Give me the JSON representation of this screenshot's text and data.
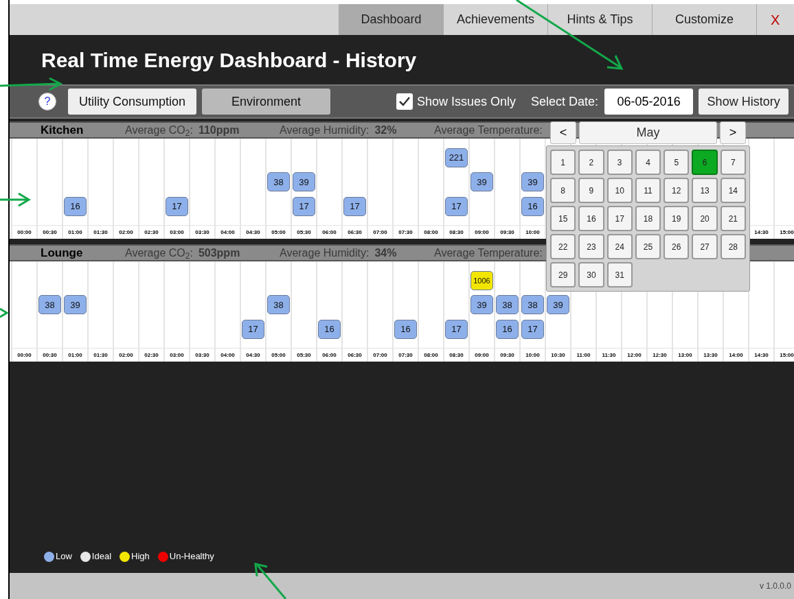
{
  "tabs": [
    {
      "label": "Dashboard",
      "selected": true
    },
    {
      "label": "Achievements",
      "selected": false
    },
    {
      "label": "Hints & Tips",
      "selected": false
    },
    {
      "label": "Customize",
      "selected": false
    }
  ],
  "close_label": "X",
  "title": "Real Time Energy Dashboard - History",
  "toolbar": {
    "help": "?",
    "views": [
      {
        "label": "Utility Consumption",
        "selected": false
      },
      {
        "label": "Environment",
        "selected": true
      }
    ],
    "show_issues": {
      "label": "Show Issues Only",
      "checked": true
    },
    "date_label": "Select Date:",
    "date_value": "06-05-2016",
    "show_history": "Show History"
  },
  "rooms": [
    {
      "name": "Kitchen",
      "stats": [
        {
          "label": "Average CO$_{2}$:",
          "value": "110ppm"
        },
        {
          "label": "Average Humidity:",
          "value": "32%"
        },
        {
          "label": "Average Temperature:"
        }
      ],
      "columns": [
        {
          "time": "00:00"
        },
        {
          "time": "00:30"
        },
        {
          "time": "01:00",
          "bottom": {
            "value": "16",
            "color": "#8eb0ea"
          }
        },
        {
          "time": "01:30"
        },
        {
          "time": "02:00"
        },
        {
          "time": "02:30"
        },
        {
          "time": "03:00",
          "bottom": {
            "value": "17",
            "color": "#8eb0ea"
          }
        },
        {
          "time": "03:30"
        },
        {
          "time": "04:00"
        },
        {
          "time": "04:30"
        },
        {
          "time": "05:00",
          "middle": {
            "value": "38",
            "color": "#8eb0ea"
          }
        },
        {
          "time": "05:30",
          "middle": {
            "value": "39",
            "color": "#8eb0ea"
          },
          "bottom": {
            "value": "17",
            "color": "#8eb0ea"
          }
        },
        {
          "time": "06:00"
        },
        {
          "time": "06:30",
          "bottom": {
            "value": "17",
            "color": "#8eb0ea"
          }
        },
        {
          "time": "07:00"
        },
        {
          "time": "07:30"
        },
        {
          "time": "08:00"
        },
        {
          "time": "08:30",
          "top": {
            "value": "221",
            "color": "#8eb0ea"
          },
          "bottom": {
            "value": "17",
            "color": "#8eb0ea"
          }
        },
        {
          "time": "09:00",
          "middle": {
            "value": "39",
            "color": "#8eb0ea"
          }
        },
        {
          "time": "09:30"
        },
        {
          "time": "10:00",
          "middle": {
            "value": "39",
            "color": "#8eb0ea"
          },
          "bottom": {
            "value": "16",
            "color": "#8eb0ea"
          }
        }
      ],
      "trailing_columns": [
        {
          "time": "14:30"
        },
        {
          "time": "15:00"
        }
      ]
    },
    {
      "name": "Lounge",
      "stats": [
        {
          "label": "Average CO$_{2}$:",
          "value": "503ppm"
        },
        {
          "label": "Average Humidity:",
          "value": "34%"
        },
        {
          "label": "Average Temperature:"
        }
      ],
      "columns": [
        {
          "time": "00:00"
        },
        {
          "time": "00:30",
          "middle": {
            "value": "38",
            "color": "#8eb0ea"
          }
        },
        {
          "time": "01:00",
          "middle": {
            "value": "39",
            "color": "#8eb0ea"
          }
        },
        {
          "time": "01:30"
        },
        {
          "time": "02:00"
        },
        {
          "time": "02:30"
        },
        {
          "time": "03:00"
        },
        {
          "time": "03:30"
        },
        {
          "time": "04:00"
        },
        {
          "time": "04:30",
          "bottom": {
            "value": "17",
            "color": "#8eb0ea"
          }
        },
        {
          "time": "05:00",
          "middle": {
            "value": "38",
            "color": "#8eb0ea"
          }
        },
        {
          "time": "05:30"
        },
        {
          "time": "06:00",
          "bottom": {
            "value": "16",
            "color": "#8eb0ea"
          }
        },
        {
          "time": "06:30"
        },
        {
          "time": "07:00"
        },
        {
          "time": "07:30",
          "bottom": {
            "value": "16",
            "color": "#8eb0ea"
          }
        },
        {
          "time": "08:00"
        },
        {
          "time": "08:30",
          "bottom": {
            "value": "17",
            "color": "#8eb0ea"
          }
        },
        {
          "time": "09:00",
          "top": {
            "value": "1006",
            "color": "#f2e600"
          },
          "middle": {
            "value": "39",
            "color": "#8eb0ea"
          }
        },
        {
          "time": "09:30",
          "middle": {
            "value": "38",
            "color": "#8eb0ea"
          },
          "bottom": {
            "value": "16",
            "color": "#8eb0ea"
          }
        },
        {
          "time": "10:00",
          "middle": {
            "value": "38",
            "color": "#8eb0ea"
          },
          "bottom": {
            "value": "17",
            "color": "#8eb0ea"
          }
        },
        {
          "time": "10:30",
          "middle": {
            "value": "39",
            "color": "#8eb0ea"
          }
        },
        {
          "time": "11:00"
        },
        {
          "time": "11:30"
        },
        {
          "time": "12:00"
        },
        {
          "time": "12:30"
        },
        {
          "time": "13:00"
        },
        {
          "time": "13:30"
        },
        {
          "time": "14:00"
        },
        {
          "time": "14:30"
        },
        {
          "time": "15:00"
        }
      ]
    }
  ],
  "calendar": {
    "prev": "<",
    "month": "May",
    "next": ">",
    "days": [
      {
        "label": "1",
        "selected": false
      },
      {
        "label": "2",
        "selected": false
      },
      {
        "label": "3",
        "selected": false
      },
      {
        "label": "4",
        "selected": false
      },
      {
        "label": "5",
        "selected": false
      },
      {
        "label": "6",
        "selected": true
      },
      {
        "label": "7",
        "selected": false
      },
      {
        "label": "8",
        "selected": false
      },
      {
        "label": "9",
        "selected": false
      },
      {
        "label": "10",
        "selected": false
      },
      {
        "label": "11",
        "selected": false
      },
      {
        "label": "12",
        "selected": false
      },
      {
        "label": "13",
        "selected": false
      },
      {
        "label": "14",
        "selected": false
      },
      {
        "label": "15",
        "selected": false
      },
      {
        "label": "16",
        "selected": false
      },
      {
        "label": "17",
        "selected": false
      },
      {
        "label": "18",
        "selected": false
      },
      {
        "label": "19",
        "selected": false
      },
      {
        "label": "20",
        "selected": false
      },
      {
        "label": "21",
        "selected": false
      },
      {
        "label": "22",
        "selected": false
      },
      {
        "label": "23",
        "selected": false
      },
      {
        "label": "24",
        "selected": false
      },
      {
        "label": "25",
        "selected": false
      },
      {
        "label": "26",
        "selected": false
      },
      {
        "label": "27",
        "selected": false
      },
      {
        "label": "28",
        "selected": false
      },
      {
        "label": "29",
        "selected": false
      },
      {
        "label": "30",
        "selected": false
      },
      {
        "label": "31",
        "selected": false
      }
    ]
  },
  "legend": [
    {
      "label": "Low",
      "color": "#8eb0ea"
    },
    {
      "label": "Ideal",
      "color": "#e6e6e6"
    },
    {
      "label": "High",
      "color": "#f2e600"
    },
    {
      "label": "Un-Healthy",
      "color": "#ee0000"
    }
  ],
  "version": "v 1.0.0.0"
}
